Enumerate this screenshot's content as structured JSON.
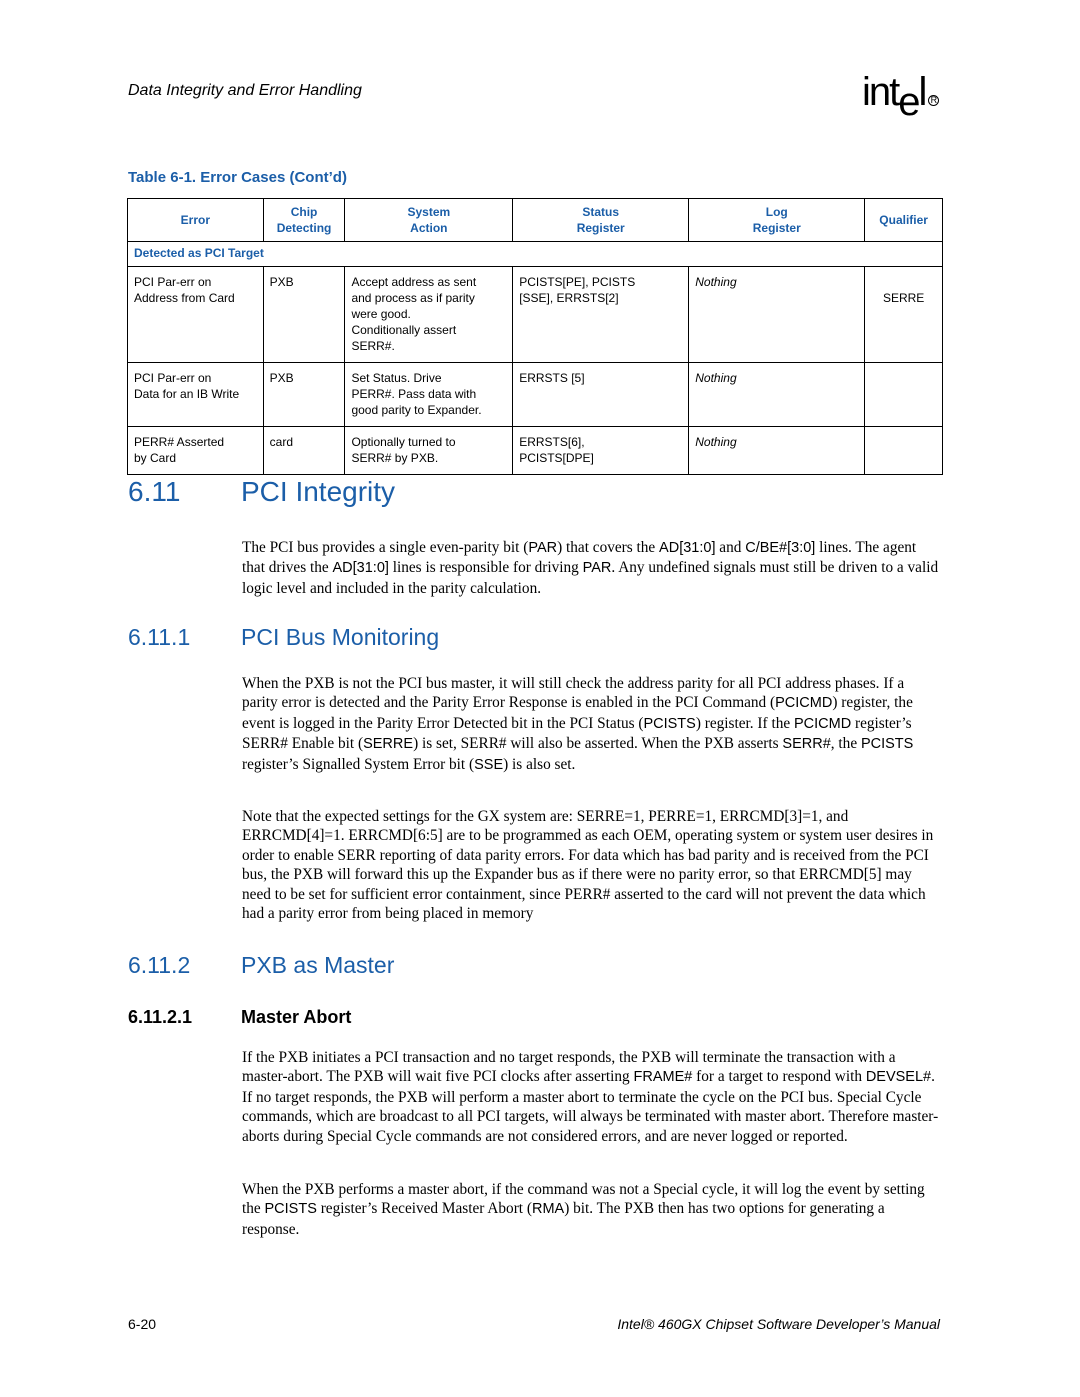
{
  "header": {
    "section_title": "Data Integrity and Error Handling",
    "logo_text": "int",
    "logo_drop": "e",
    "logo_tail": "l",
    "logo_reg": "R"
  },
  "table": {
    "caption": "Table 6-1. Error Cases (Cont’d)",
    "columns": [
      {
        "line1": "Error",
        "line2": ""
      },
      {
        "line1": "Chip",
        "line2": "Detecting"
      },
      {
        "line1": "System",
        "line2": "Action"
      },
      {
        "line1": "Status",
        "line2": "Register"
      },
      {
        "line1": "Log",
        "line2": "Register"
      },
      {
        "line1": "Qualifier",
        "line2": ""
      }
    ],
    "group_label": "Detected as PCI Target",
    "rows": [
      {
        "error": [
          "PCI Par-err on",
          "Address from Card"
        ],
        "chip": "PXB",
        "action": [
          "Accept address as sent",
          "and process as if parity",
          "were good.",
          "Conditionally assert",
          "SERR#."
        ],
        "status": [
          "PCISTS[PE], PCISTS",
          "[SSE], ERRSTS[2]"
        ],
        "log": "Nothing",
        "qualifier": "SERRE"
      },
      {
        "error": [
          "PCI Par-err on",
          "Data for an IB Write"
        ],
        "chip": "PXB",
        "action": [
          "Set Status. Drive",
          "PERR#. Pass data with",
          "good parity to Expander."
        ],
        "status": [
          "ERRSTS [5]"
        ],
        "log": "Nothing",
        "qualifier": ""
      },
      {
        "error": [
          "PERR# Asserted",
          "by Card"
        ],
        "chip": "card",
        "action": [
          "Optionally turned to",
          "SERR# by PXB."
        ],
        "status": [
          "ERRSTS[6],",
          "PCISTS[DPE]"
        ],
        "log": "Nothing",
        "qualifier": ""
      }
    ]
  },
  "sections": {
    "s611": {
      "number": "6.11",
      "title": "PCI Integrity",
      "para": [
        "The PCI bus provides a single even-parity bit (",
        "PAR",
        ") that covers the ",
        "AD[31:0]",
        " and ",
        "C/BE#[3:0]",
        " lines. The agent that drives the ",
        "AD[31:0]",
        " lines is responsible for driving ",
        "PAR",
        ". Any undefined signals must still be driven to a valid logic level and included in the parity calculation."
      ]
    },
    "s6111": {
      "number": "6.11.1",
      "title": "PCI Bus Monitoring",
      "para1": [
        "When the PXB is not the PCI bus master, it will still check the address parity for all PCI address phases. If a parity error is detected and the Parity Error Response is enabled in the PCI Command (",
        "PCICMD",
        ") register, the event is logged in the Parity Error Detected bit in the PCI Status (",
        "PCISTS",
        ") register. If the ",
        "PCICMD",
        " register’s SERR# Enable bit (",
        "SERRE",
        ") is set, SERR# will also be asserted. When the PXB asserts ",
        "SERR#",
        ", the ",
        "PCISTS",
        " register’s Signalled System Error bit (",
        "SSE",
        ") is also set."
      ],
      "para2": "Note that the expected settings for the GX system are: SERRE=1, PERRE=1, ERRCMD[3]=1, and ERRCMD[4]=1. ERRCMD[6:5] are to be programmed as each OEM, operating system or system user desires in order to enable SERR reporting of data parity errors. For data which has bad parity and is received from the PCI bus, the PXB will forward this up the Expander bus as if there were no parity error, so that ERRCMD[5] may need to be set for sufficient error containment, since PERR# asserted to the card will not prevent the data which had a parity error from being placed in memory"
    },
    "s6112": {
      "number": "6.11.2",
      "title": "PXB as Master"
    },
    "s61121": {
      "number": "6.11.2.1",
      "title": "Master Abort",
      "para1": [
        "If the PXB initiates a PCI transaction and no target responds, the PXB will terminate the transaction with a master-abort. The PXB will wait five PCI clocks after asserting ",
        "FRAME#",
        " for a target to respond with ",
        "DEVSEL#",
        ". If no target responds, the PXB will perform a master abort to terminate the cycle on the PCI bus. Special Cycle commands, which are broadcast to all PCI targets, will always be terminated with master abort. Therefore master-aborts during Special Cycle commands are not considered errors, and are never logged or reported."
      ],
      "para2": [
        "When the PXB performs a master abort, if the command was not a Special cycle, it will log the event by setting the ",
        "PCISTS",
        " register’s Received Master Abort (",
        "RMA",
        ") bit. The PXB then has two options for generating a response."
      ]
    }
  },
  "footer": {
    "page_number": "6-20",
    "manual_title": "Intel® 460GX Chipset Software Developer’s Manual"
  }
}
